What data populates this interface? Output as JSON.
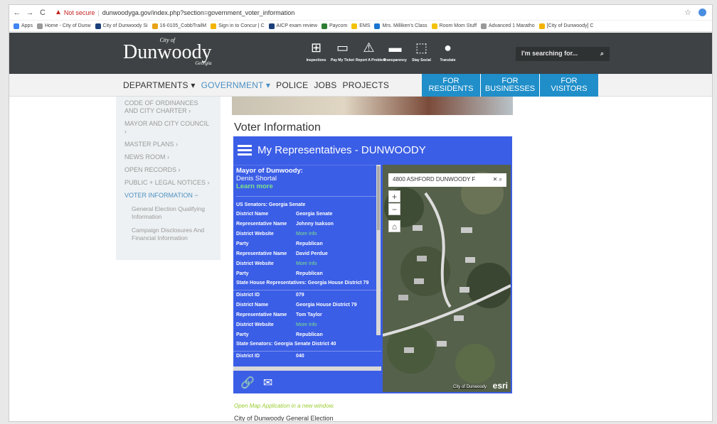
{
  "browser": {
    "nav_back": "←",
    "nav_forward": "→",
    "nav_reload": "C",
    "security": "Not secure",
    "url": "dunwoodyga.gov/index.php?section=government_voter_information",
    "bookmarks": [
      {
        "label": "Apps",
        "color": "#4285f4"
      },
      {
        "label": "Home - City of Dunw",
        "color": "#999"
      },
      {
        "label": "City of Dunwoody Si",
        "color": "#1a3f7a"
      },
      {
        "label": "16-0105_CobbTrailM",
        "color": "#e8a317"
      },
      {
        "label": "Sign in to Concur | C",
        "color": "#f4b400"
      },
      {
        "label": "AICP exam review",
        "color": "#1a3f7a"
      },
      {
        "label": "Paycom",
        "color": "#2e7d32"
      },
      {
        "label": "EMS",
        "color": "#f4c20d"
      },
      {
        "label": "Mrs. Milliken's Class",
        "color": "#1976d2"
      },
      {
        "label": "Room Mom Stuff",
        "color": "#f4c20d"
      },
      {
        "label": "Advanced 1 Maratho",
        "color": "#999"
      },
      {
        "label": "[City of Dunwoody] C",
        "color": "#f4b400"
      }
    ]
  },
  "header": {
    "logo_top": "City of",
    "logo_main": "Dunwoody",
    "logo_sub": "Georgia",
    "icons": [
      {
        "label": "Inspections",
        "glyph": "⊞",
        "name": "inspections-icon"
      },
      {
        "label": "Pay My Ticket",
        "glyph": "▭",
        "name": "ticket-icon"
      },
      {
        "label": "Report A Problem",
        "glyph": "⚠",
        "name": "warning-icon"
      },
      {
        "label": "Transparency",
        "glyph": "▬",
        "name": "chat-icon"
      },
      {
        "label": "Stay Social",
        "glyph": "⬚",
        "name": "social-icon"
      },
      {
        "label": "Translate",
        "glyph": "●",
        "name": "globe-icon"
      }
    ],
    "search_placeholder": "I'm searching for...",
    "search_glyph": "⌕"
  },
  "nav": {
    "departments": "DEPARTMENTS",
    "government": "GOVERNMENT",
    "police": "POLICE",
    "jobs": "JOBS",
    "projects": "PROJECTS",
    "caret": "▾",
    "residents": [
      "FOR",
      "RESIDENTS"
    ],
    "businesses": [
      "FOR",
      "BUSINESSES"
    ],
    "visitors": [
      "FOR",
      "VISITORS"
    ]
  },
  "sidebar": {
    "items": [
      "CODE OF ORDINANCES AND CITY CHARTER ›",
      "MAYOR AND CITY COUNCIL ›",
      "MASTER PLANS ›",
      "NEWS ROOM ›",
      "OPEN RECORDS ›",
      "PUBLIC + LEGAL NOTICES ›",
      "VOTER INFORMATION −"
    ],
    "subitems": [
      "General Election Qualifying Information",
      "Campaign Disclosures And Financial Information"
    ]
  },
  "content": {
    "title": "Voter Information",
    "widget_title": "My Representatives - DUNWOODY",
    "mayor_label": "Mayor of Dunwoody:",
    "mayor_name": "Denis Shortal",
    "learn_more": "Learn more",
    "us_senators": "US Senators: Georgia Senate",
    "rows1": [
      {
        "k": "District Name",
        "v": "Georgia Senate",
        "link": false
      },
      {
        "k": "Representative Name",
        "v": "Johnny Isakson",
        "link": false
      },
      {
        "k": "District Website",
        "v": "More Info",
        "link": true
      },
      {
        "k": "Party",
        "v": "Republican",
        "link": false
      },
      {
        "k": "Representative Name",
        "v": "David Perdue",
        "link": false
      },
      {
        "k": "District Website",
        "v": "More Info",
        "link": true
      },
      {
        "k": "Party",
        "v": "Republican",
        "link": false
      }
    ],
    "state_house": "State House Representatives: Georgia House District 79",
    "rows2": [
      {
        "k": "District ID",
        "v": "079",
        "link": false
      },
      {
        "k": "District Name",
        "v": "Georgia House District 79",
        "link": false
      },
      {
        "k": "Representative Name",
        "v": "Tom Taylor",
        "link": false
      },
      {
        "k": "District Website",
        "v": "More Info",
        "link": true
      },
      {
        "k": "Party",
        "v": "Republican",
        "link": false
      }
    ],
    "state_senators": "State Senators: Georgia Senate District 40",
    "rows3": [
      {
        "k": "District ID",
        "v": "040",
        "link": false
      }
    ],
    "map_search": "4800 ASHFORD DUNWOODY F",
    "map_search_clear": "✕",
    "map_search_glyph": "⌕",
    "map_zoom_in": "+",
    "map_zoom_out": "−",
    "map_home": "⌂",
    "map_attribution": "City of Dunwoody",
    "map_logo": "esri",
    "foot_link": "🔗",
    "foot_mail": "✉",
    "open_map": "Open Map Application in a new window.",
    "election": "City of Dunwoody General Election"
  }
}
